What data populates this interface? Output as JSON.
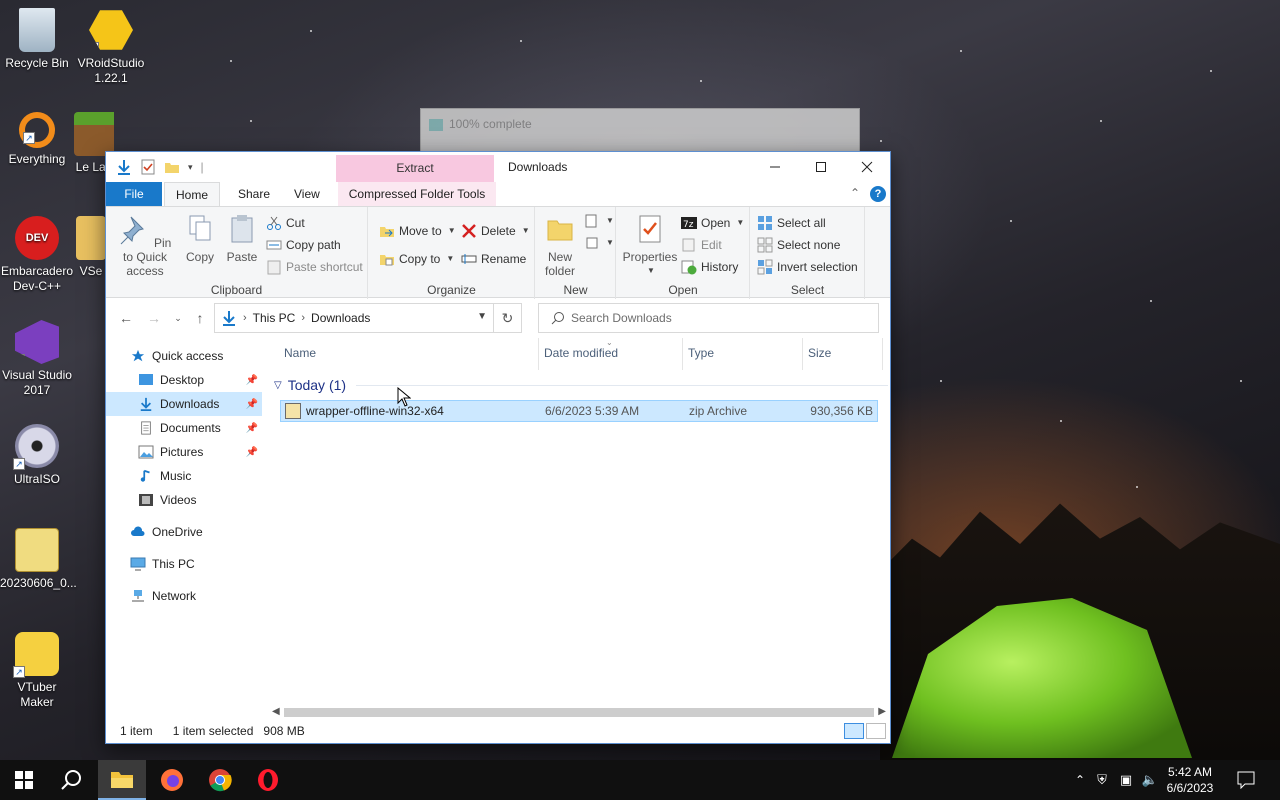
{
  "desktop": {
    "icons": [
      {
        "label": "Recycle Bin",
        "icon": "recycle-bin-icon"
      },
      {
        "label": "VRoidStudio 1.22.1",
        "icon": "vroid-icon"
      },
      {
        "label": "Everything",
        "icon": "everything-icon"
      },
      {
        "label": "Le Lau",
        "icon": "minecraft-launcher-icon"
      },
      {
        "label": "Embarcadero Dev-C++",
        "icon": "devcpp-icon"
      },
      {
        "label": "VSe",
        "icon": "folder-icon"
      },
      {
        "label": "Visual Studio 2017",
        "icon": "visual-studio-icon"
      },
      {
        "label": "UltraISO",
        "icon": "ultraiso-icon"
      },
      {
        "label": "20230606_0...",
        "icon": "iso-file-icon"
      },
      {
        "label": "VTuber Maker",
        "icon": "vtuber-maker-icon"
      }
    ]
  },
  "progress_dialog": {
    "text": "100% complete"
  },
  "window": {
    "title": "Downloads",
    "contextual_tab": "Extract",
    "tabs": {
      "file": "File",
      "home": "Home",
      "share": "Share",
      "view": "View",
      "compressed": "Compressed Folder Tools"
    },
    "ribbon": {
      "clipboard": {
        "label": "Clipboard",
        "pin": "Pin to Quick access",
        "copy": "Copy",
        "paste": "Paste",
        "cut": "Cut",
        "copy_path": "Copy path",
        "paste_shortcut": "Paste shortcut"
      },
      "organize": {
        "label": "Organize",
        "move_to": "Move to",
        "copy_to": "Copy to",
        "delete": "Delete",
        "rename": "Rename"
      },
      "new": {
        "label": "New",
        "new_folder": "New folder"
      },
      "open": {
        "label": "Open",
        "properties": "Properties",
        "open": "Open",
        "edit": "Edit",
        "history": "History"
      },
      "select": {
        "label": "Select",
        "select_all": "Select all",
        "select_none": "Select none",
        "invert": "Invert selection"
      }
    },
    "address": {
      "crumbs": [
        "This PC",
        "Downloads"
      ]
    },
    "search": {
      "placeholder": "Search Downloads"
    },
    "nav": {
      "quick_access": "Quick access",
      "desktop": "Desktop",
      "downloads": "Downloads",
      "documents": "Documents",
      "pictures": "Pictures",
      "music": "Music",
      "videos": "Videos",
      "onedrive": "OneDrive",
      "this_pc": "This PC",
      "network": "Network"
    },
    "columns": {
      "name": "Name",
      "date": "Date modified",
      "type": "Type",
      "size": "Size"
    },
    "group": {
      "label": "Today (1)"
    },
    "files": [
      {
        "name": "wrapper-offline-win32-x64",
        "date": "6/6/2023 5:39 AM",
        "type": "zip Archive",
        "size": "930,356 KB"
      }
    ],
    "status": {
      "count": "1 item",
      "selected": "1 item selected",
      "size": "908 MB"
    }
  },
  "taskbar": {
    "time": "5:42 AM",
    "date": "6/6/2023"
  },
  "colors": {
    "accent": "#1979ca",
    "selection": "#cce8ff",
    "contextual": "#f8c8e0"
  }
}
